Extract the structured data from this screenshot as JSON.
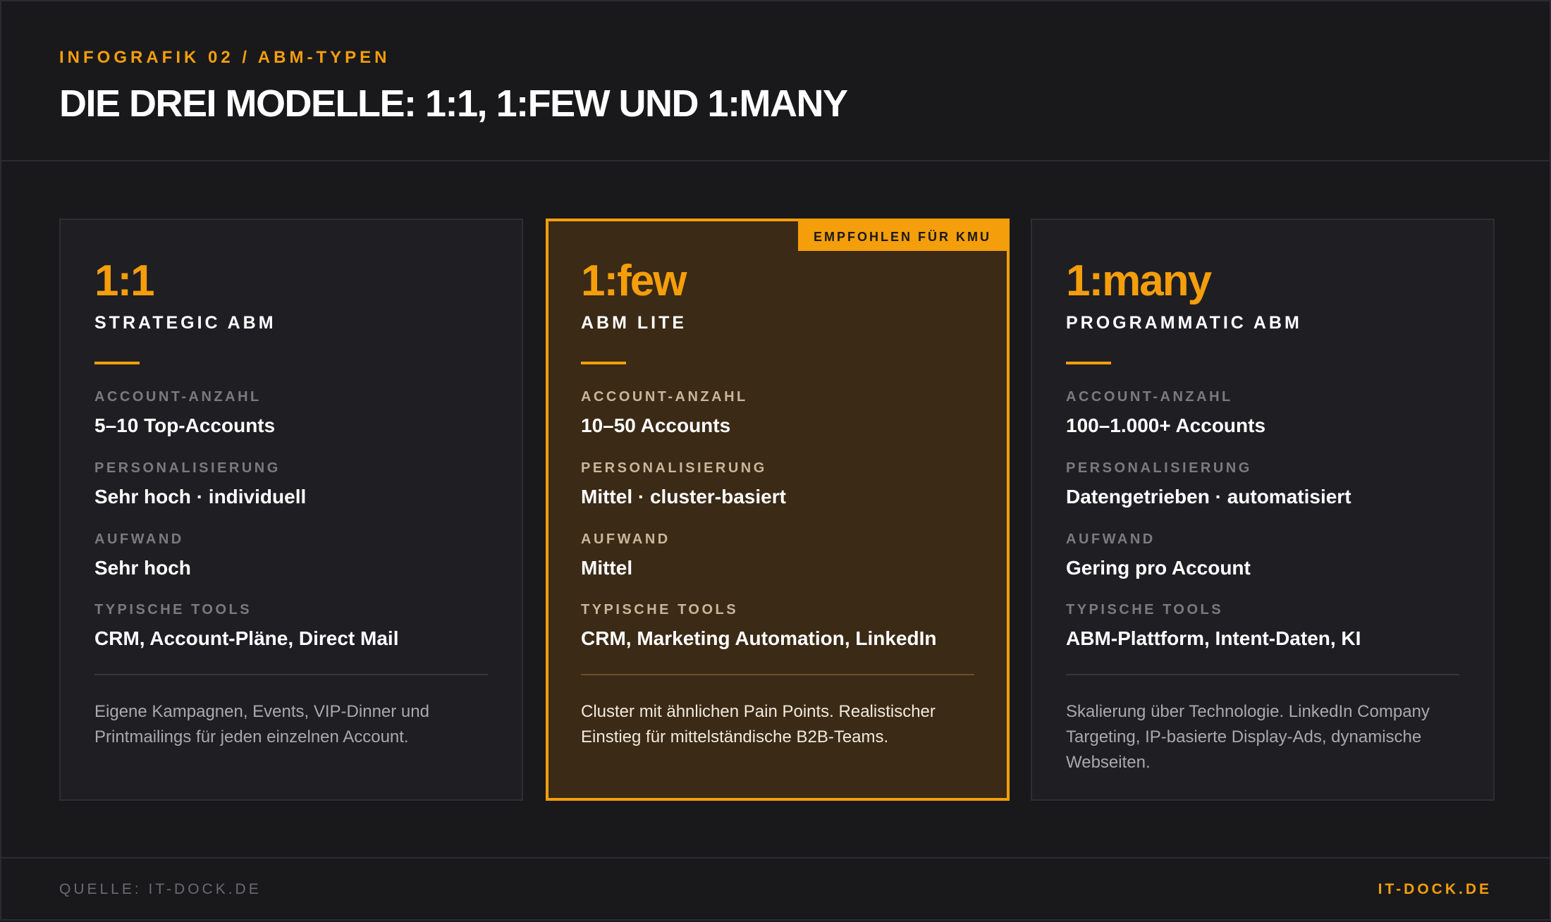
{
  "header": {
    "eyebrow": "INFOGRAFIK 02 / ABM-TYPEN",
    "title": "DIE DREI MODELLE: 1:1, 1:FEW UND 1:MANY"
  },
  "cards": [
    {
      "model": "1:1",
      "subtitle": "STRATEGIC ABM",
      "fields": [
        {
          "label": "ACCOUNT-ANZAHL",
          "value": "5–10 Top-Accounts"
        },
        {
          "label": "PERSONALISIERUNG",
          "value": "Sehr hoch · individuell"
        },
        {
          "label": "AUFWAND",
          "value": "Sehr hoch"
        },
        {
          "label": "TYPISCHE TOOLS",
          "value": "CRM, Account-Pläne, Direct Mail"
        }
      ],
      "description": "Eigene Kampagnen, Events, VIP-Dinner und Printmailings für jeden einzelnen Account."
    },
    {
      "model": "1:few",
      "subtitle": "ABM LITE",
      "badge": "EMPFOHLEN FÜR KMU",
      "fields": [
        {
          "label": "ACCOUNT-ANZAHL",
          "value": "10–50 Accounts"
        },
        {
          "label": "PERSONALISIERUNG",
          "value": "Mittel · cluster-basiert"
        },
        {
          "label": "AUFWAND",
          "value": "Mittel"
        },
        {
          "label": "TYPISCHE TOOLS",
          "value": "CRM, Marketing Automation, LinkedIn"
        }
      ],
      "description": "Cluster mit ähnlichen Pain Points. Realistischer Einstieg für mittelständische B2B-Teams."
    },
    {
      "model": "1:many",
      "subtitle": "PROGRAMMATIC ABM",
      "fields": [
        {
          "label": "ACCOUNT-ANZAHL",
          "value": "100–1.000+ Accounts"
        },
        {
          "label": "PERSONALISIERUNG",
          "value": "Datengetrieben · automatisiert"
        },
        {
          "label": "AUFWAND",
          "value": "Gering pro Account"
        },
        {
          "label": "TYPISCHE TOOLS",
          "value": "ABM-Plattform, Intent-Daten, KI"
        }
      ],
      "description": "Skalierung über Technologie. LinkedIn Company Targeting, IP-basierte Display-Ads, dynamische Webseiten."
    }
  ],
  "footer": {
    "source": "QUELLE: IT-DOCK.DE",
    "brand": "IT-DOCK.DE"
  },
  "colors": {
    "accent": "#f59e0b",
    "background": "#19191b",
    "card": "#1f1f23",
    "highlight_card": "#3a2a16"
  }
}
